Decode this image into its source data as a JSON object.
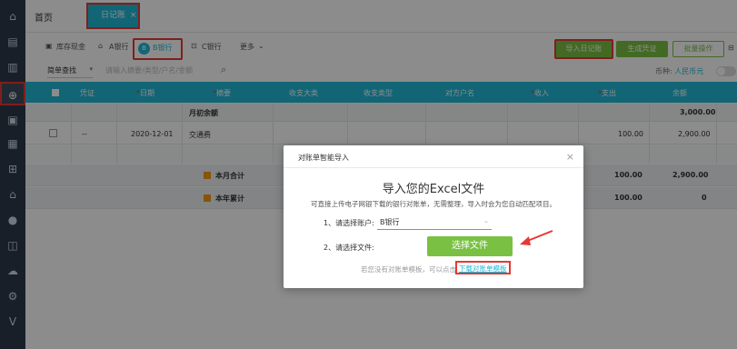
{
  "sidebar": {
    "icons": [
      "home-icon",
      "doc-icon",
      "chart-icon",
      "money-bag-icon",
      "receipt-icon",
      "calc-icon",
      "building-icon",
      "house-icon",
      "coins-icon",
      "stamp-icon",
      "cloud-icon",
      "gear-icon",
      "v-icon"
    ]
  },
  "tabs": {
    "home": "首页",
    "active": "日记账",
    "close": "×"
  },
  "toolbar": {
    "cash": "库存现金",
    "bank_a": "A银行",
    "bank_b": "B银行",
    "bank_b_icon": "B",
    "bank_c": "C银行",
    "more": "更多",
    "import": "导入日记账",
    "voucher": "生成凭证",
    "batch": "批量操作"
  },
  "search": {
    "mode": "简单查找",
    "placeholder": "请输入摘要/类型/户名/金额",
    "currency_label": "币种:",
    "currency_value": "人民币元"
  },
  "table": {
    "headers": [
      "凭证",
      "日期",
      "摘要",
      "收支大类",
      "收支类型",
      "对方户名",
      "收入",
      "支出",
      "余额"
    ],
    "opening": {
      "label": "月初余额",
      "balance": "3,000.00"
    },
    "row": {
      "voucher": "--",
      "date": "2020-12-01",
      "summary": "交通费",
      "expense": "100.00",
      "balance": "2,900.00"
    },
    "month_total": {
      "label": "本月合计",
      "expense": "100.00",
      "balance": "2,900.00"
    },
    "year_total": {
      "label": "本年累计",
      "expense": "100.00",
      "balance": "0"
    }
  },
  "modal": {
    "title": "对账单智能导入",
    "close": "×",
    "heading": "导入您的Excel文件",
    "desc": "可直接上传电子网银下载的银行对账单，无需整理，导入时会为您自动匹配项目。",
    "account_label": "1、请选择账户:",
    "account_value": "B银行",
    "file_label": "2、请选择文件:",
    "choose_button": "选择文件",
    "tip": "若您没有对账单模板，可以点击",
    "download_link": "下载对账单模板"
  },
  "colors": {
    "primary": "#21b8d6",
    "green": "#7ac143",
    "highlight": "#e53935",
    "sidebar": "#2d3a4b"
  }
}
